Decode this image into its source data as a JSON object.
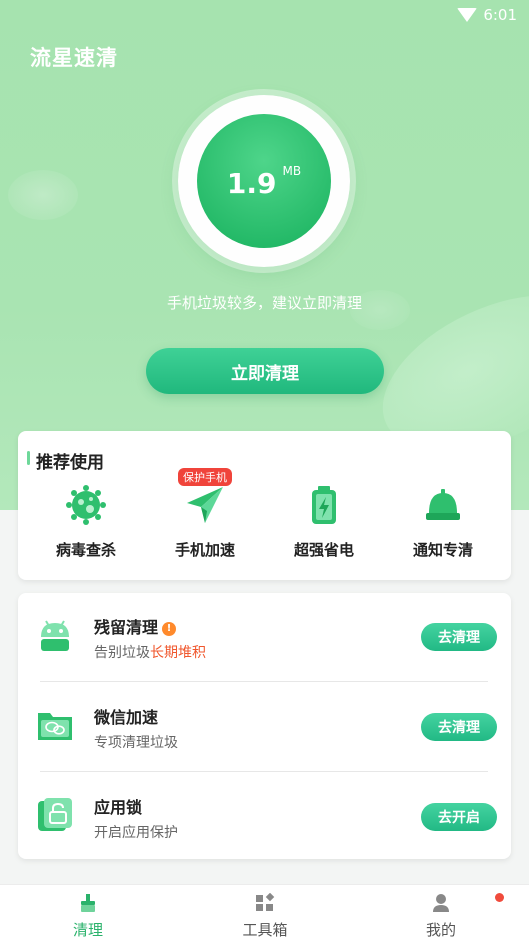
{
  "status_bar": {
    "time": "6:01"
  },
  "app_title": "流星速清",
  "gauge": {
    "value": "1.9",
    "unit": "MB"
  },
  "hint": "手机垃圾较多，建议立即清理",
  "clean_button": "立即清理",
  "recommend": {
    "title": "推荐使用",
    "badge": "保护手机",
    "items": [
      {
        "label": "病毒查杀",
        "icon": "virus-icon"
      },
      {
        "label": "手机加速",
        "icon": "paper-plane-icon"
      },
      {
        "label": "超强省电",
        "icon": "battery-icon"
      },
      {
        "label": "通知专清",
        "icon": "bell-icon"
      }
    ]
  },
  "features": [
    {
      "title": "残留清理",
      "subtitle_prefix": "告别垃圾",
      "subtitle_highlight": "长期堆积",
      "button": "去清理",
      "icon": "android-residue-icon"
    },
    {
      "title": "微信加速",
      "subtitle_prefix": "专项清理垃圾",
      "subtitle_highlight": "",
      "button": "去清理",
      "icon": "wechat-folder-icon"
    },
    {
      "title": "应用锁",
      "subtitle_prefix": "开启应用保护",
      "subtitle_highlight": "",
      "button": "去开启",
      "icon": "app-lock-icon"
    }
  ],
  "nav": {
    "items": [
      {
        "label": "清理",
        "icon": "broom-icon",
        "active": true
      },
      {
        "label": "工具箱",
        "icon": "toolbox-icon",
        "active": false
      },
      {
        "label": "我的",
        "icon": "profile-icon",
        "active": false
      }
    ]
  },
  "colors": {
    "brand": "#22b866",
    "accent_button": "#20b87d",
    "highlight": "#f0572d",
    "badge": "#f0443b"
  }
}
